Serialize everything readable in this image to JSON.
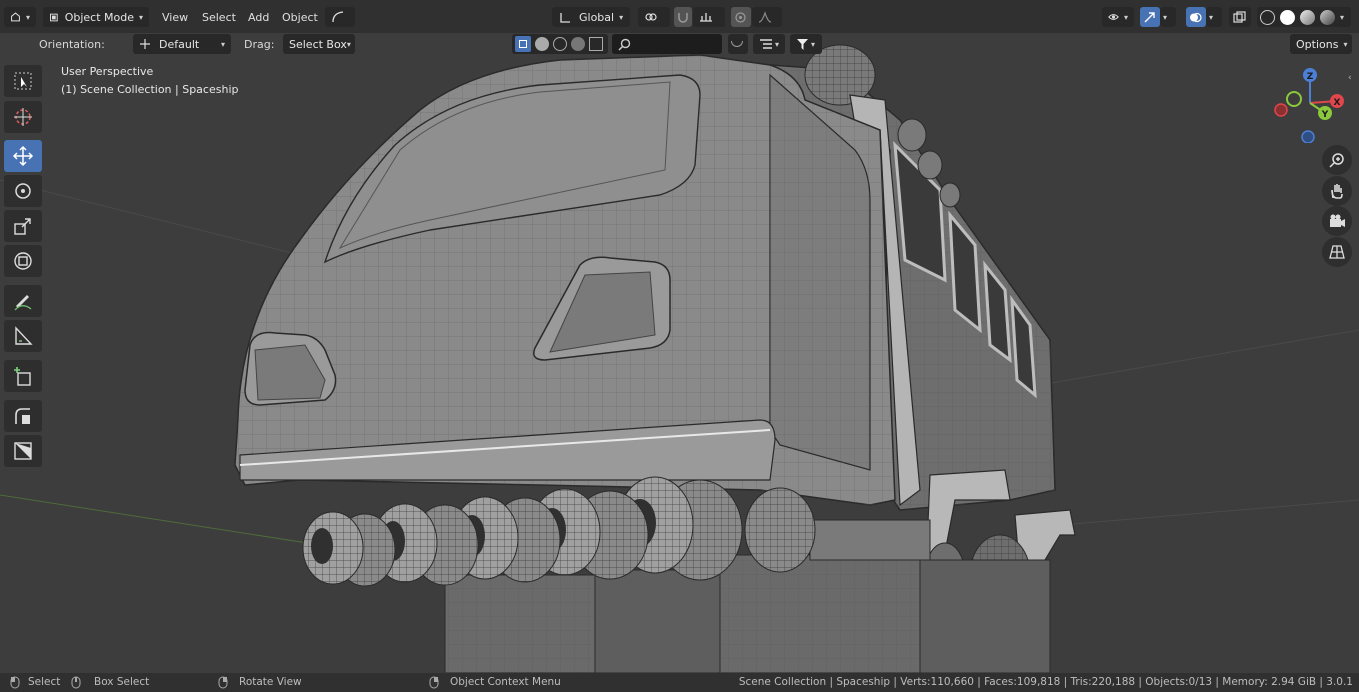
{
  "header": {
    "mode_label": "Object Mode",
    "menus": [
      "View",
      "Select",
      "Add",
      "Object"
    ],
    "transform_orientation": "Global",
    "options_label": "Options"
  },
  "tool_settings": {
    "orientation_label": "Orientation:",
    "orientation_value": "Default",
    "drag_label": "Drag:",
    "drag_value": "Select Box"
  },
  "viewport": {
    "view_name": "User Perspective",
    "collection_path": "(1) Scene Collection | Spaceship",
    "gizmo_axes": [
      "X",
      "Y",
      "Z"
    ]
  },
  "toolbar": {
    "tools": [
      "select-box",
      "cursor",
      "move",
      "rotate",
      "scale",
      "transform",
      "annotate",
      "measure",
      "add-cube",
      "extrude",
      "inset"
    ],
    "active_tool": "move"
  },
  "statusbar": {
    "select": "Select",
    "box_select": "Box Select",
    "rotate_view": "Rotate View",
    "context_menu": "Object Context Menu",
    "stats": "Scene Collection | Spaceship | Verts:110,660 | Faces:109,818 | Tris:220,188 | Objects:0/13 | Memory: 2.94 GiB | 3.0.1"
  },
  "colors": {
    "accent": "#4772b3",
    "header_bg": "#303030",
    "viewport_bg": "#3d3d3d"
  }
}
